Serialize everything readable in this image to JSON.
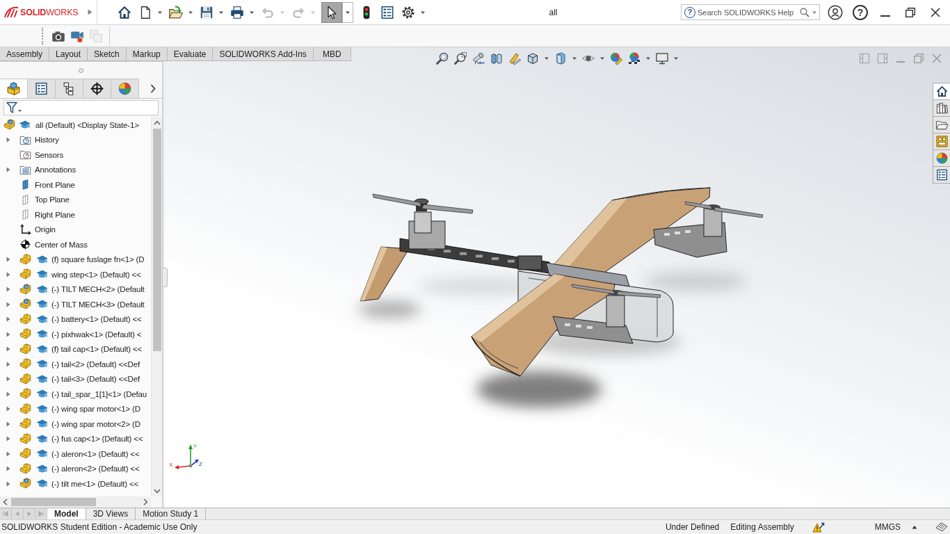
{
  "app": {
    "logo": "**SOLID**WORKS",
    "title": "all"
  },
  "quick_access_toolbar": [
    {
      "kind": "home",
      "dropdown": false,
      "disabled": false,
      "pressed": false
    },
    {
      "kind": "new",
      "dropdown": true,
      "disabled": false,
      "pressed": false
    },
    {
      "kind": "open",
      "dropdown": true,
      "disabled": false,
      "pressed": false
    },
    {
      "kind": "save",
      "dropdown": true,
      "disabled": false,
      "pressed": false
    },
    {
      "kind": "print",
      "dropdown": true,
      "disabled": false,
      "pressed": false
    },
    {
      "kind": "undo",
      "dropdown": true,
      "disabled": true,
      "pressed": false
    },
    {
      "kind": "redo",
      "dropdown": true,
      "disabled": true,
      "pressed": false
    },
    {
      "kind": "select",
      "dropdown": true,
      "disabled": false,
      "pressed": true
    },
    {
      "kind": "rebuild",
      "dropdown": false,
      "disabled": false,
      "pressed": false
    },
    {
      "kind": "properties",
      "dropdown": false,
      "disabled": false,
      "pressed": false
    },
    {
      "kind": "options",
      "dropdown": true,
      "disabled": false,
      "pressed": false
    }
  ],
  "search": {
    "help": "?",
    "placeholder": "Search SOLIDWORKS Help"
  },
  "window_controls": {
    "help": "?"
  },
  "secondary_toolbar": [
    {
      "kind": "snapshot",
      "disabled": false
    },
    {
      "kind": "record",
      "disabled": false
    },
    {
      "kind": "playback",
      "disabled": true
    }
  ],
  "command_tabs": [
    {
      "label": "Assembly",
      "selected": false
    },
    {
      "label": "Layout",
      "selected": false
    },
    {
      "label": "Sketch",
      "selected": false
    },
    {
      "label": "Markup",
      "selected": false
    },
    {
      "label": "Evaluate",
      "selected": false
    },
    {
      "label": "SOLIDWORKS Add-Ins",
      "selected": false
    },
    {
      "label": "MBD",
      "selected": false
    }
  ],
  "feature_manager": {
    "tabs": [
      {
        "kind": "feature-tree",
        "selected": true
      },
      {
        "kind": "property-manager",
        "selected": false
      },
      {
        "kind": "configuration-manager",
        "selected": false
      },
      {
        "kind": "dimxpert",
        "selected": false
      },
      {
        "kind": "display-manager",
        "selected": false
      }
    ],
    "tree": {
      "label": "all (Default) <Display State-1>",
      "kind": "assembly",
      "children": [
        {
          "label": "History",
          "kind": "history",
          "expander": true
        },
        {
          "label": "Sensors",
          "kind": "sensors",
          "expander": false
        },
        {
          "label": "Annotations",
          "kind": "annotations",
          "expander": true
        },
        {
          "label": "Front Plane",
          "kind": "plane-shaded",
          "expander": false
        },
        {
          "label": "Top Plane",
          "kind": "plane",
          "expander": false
        },
        {
          "label": "Right Plane",
          "kind": "plane",
          "expander": false
        },
        {
          "label": "Origin",
          "kind": "origin",
          "expander": false
        },
        {
          "label": "Center of Mass",
          "kind": "center-of-mass",
          "expander": false
        },
        {
          "label": "(f) square fuslage fn<1> (D",
          "kind": "part",
          "expander": true
        },
        {
          "label": "wing step<1> (Default) <<",
          "kind": "part",
          "expander": true
        },
        {
          "label": "(-) TILT MECH<2> (Default",
          "kind": "assembly",
          "expander": true
        },
        {
          "label": "(-) TILT MECH<3> (Default",
          "kind": "assembly",
          "expander": true
        },
        {
          "label": "(-) battery<1> (Default) <<",
          "kind": "part",
          "expander": true
        },
        {
          "label": "(-) pixhwak<1> (Default) <",
          "kind": "part",
          "expander": true
        },
        {
          "label": "(f) tail cap<1> (Default) <<",
          "kind": "part",
          "expander": true
        },
        {
          "label": "(-) tail<2> (Default) <<Def",
          "kind": "part",
          "expander": true
        },
        {
          "label": "(-) tail<3> (Default) <<Def",
          "kind": "part",
          "expander": true
        },
        {
          "label": "(-) tail_spar_1[1]<1> (Defau",
          "kind": "part",
          "expander": true
        },
        {
          "label": "(-) wing spar motor<1> (D",
          "kind": "part",
          "expander": true
        },
        {
          "label": "(-) wing spar motor<2> (D",
          "kind": "part",
          "expander": true
        },
        {
          "label": "(-) fus cap<1> (Default) <<",
          "kind": "part",
          "expander": true
        },
        {
          "label": "(-) aleron<1> (Default) <<",
          "kind": "part",
          "expander": true
        },
        {
          "label": "(-) aleron<2> (Default) <<",
          "kind": "part",
          "expander": true
        },
        {
          "label": "(-) tilt me<1> (Default) <<",
          "kind": "assembly",
          "expander": true
        }
      ]
    }
  },
  "view_toolbar": [
    {
      "kind": "zoom-fit",
      "dropdown": false
    },
    {
      "kind": "zoom-area",
      "dropdown": false
    },
    {
      "kind": "previous-view",
      "dropdown": false
    },
    {
      "kind": "section-view",
      "dropdown": false
    },
    {
      "kind": "annotation-view",
      "dropdown": false
    },
    {
      "kind": "view-orientation",
      "dropdown": true
    },
    {
      "kind": "display-style",
      "dropdown": true
    },
    {
      "kind": "hide-show",
      "dropdown": true
    },
    {
      "kind": "edit-appearance",
      "dropdown": false
    },
    {
      "kind": "apply-scene",
      "dropdown": true
    },
    {
      "kind": "view-settings",
      "dropdown": true
    }
  ],
  "task_pane": [
    {
      "kind": "home",
      "selected": true
    },
    {
      "kind": "design-library",
      "selected": false
    },
    {
      "kind": "file-explorer",
      "selected": false
    },
    {
      "kind": "view-palette",
      "selected": false
    },
    {
      "kind": "appearances",
      "selected": false
    },
    {
      "kind": "custom-properties",
      "selected": false
    }
  ],
  "triad": {
    "y": "Y",
    "x": "X",
    "z": "Z"
  },
  "bottom_tabs": [
    {
      "label": "Model",
      "selected": true
    },
    {
      "label": "3D Views",
      "selected": false
    },
    {
      "label": "Motion Study 1",
      "selected": false
    }
  ],
  "status_bar": {
    "edition": "SOLIDWORKS Student Edition - Academic Use Only",
    "definition": "Under Defined",
    "mode": "Editing Assembly",
    "units": "MMGS"
  }
}
